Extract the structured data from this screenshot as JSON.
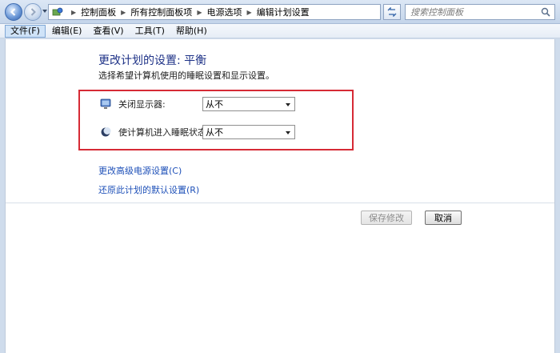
{
  "address_bar": {
    "path": [
      "控制面板",
      "所有控制面板项",
      "电源选项",
      "编辑计划设置"
    ],
    "search_placeholder": "搜索控制面板"
  },
  "menu": {
    "items": [
      {
        "label": "文件(F)",
        "active": true
      },
      {
        "label": "编辑(E)",
        "active": false
      },
      {
        "label": "查看(V)",
        "active": false
      },
      {
        "label": "工具(T)",
        "active": false
      },
      {
        "label": "帮助(H)",
        "active": false
      }
    ]
  },
  "main": {
    "title": "更改计划的设置: 平衡",
    "subtitle": "选择希望计算机使用的睡眠设置和显示设置。",
    "settings": [
      {
        "label": "关闭显示器:",
        "value": "从不",
        "icon": "monitor-icon"
      },
      {
        "label": "使计算机进入睡眠状态:",
        "value": "从不",
        "icon": "sleep-moon-icon"
      }
    ],
    "links": [
      "更改高级电源设置(C)",
      "还原此计划的默认设置(R)"
    ],
    "buttons": {
      "save": "保存修改",
      "cancel": "取消"
    }
  },
  "colors": {
    "highlight_border": "#d62a35",
    "title": "#1e3287",
    "link": "#1e50b8"
  }
}
